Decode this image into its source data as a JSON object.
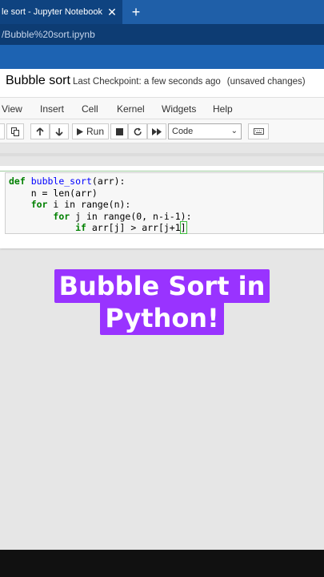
{
  "browser": {
    "tab_title": "le sort - Jupyter Notebook",
    "tab_close": "✕",
    "new_tab": "+",
    "address": "/Bubble%20sort.ipynb"
  },
  "notebook": {
    "title": "Bubble sort",
    "checkpoint": "Last Checkpoint: a few seconds ago",
    "status": "(unsaved changes)"
  },
  "menu": [
    "View",
    "Insert",
    "Cell",
    "Kernel",
    "Widgets",
    "Help"
  ],
  "toolbar": {
    "run_label": "Run",
    "cell_type": "Code",
    "icons": [
      "copy-icon",
      "arrow-up-icon",
      "arrow-down-icon",
      "play-icon",
      "stop-icon",
      "restart-icon",
      "fast-forward-icon",
      "keyboard-icon"
    ]
  },
  "code": {
    "line1_kw": "def",
    "line1_fn": "bubble_sort",
    "line1_rest": "(arr):",
    "line2": "    n = len(arr)",
    "line3_kw": "for",
    "line3_rest": " i in range(n):",
    "line4_kw": "for",
    "line4_rest": " j in range(0, n-i-1):",
    "line5_kw": "if",
    "line5_rest": " arr[j] > arr[j+1"
  },
  "caption": {
    "line1": "Bubble Sort in",
    "line2": "Python!"
  },
  "colors": {
    "caption_bg": "#9933ff",
    "browser_blue": "#1f5fa8",
    "keyword_green": "#008000"
  }
}
